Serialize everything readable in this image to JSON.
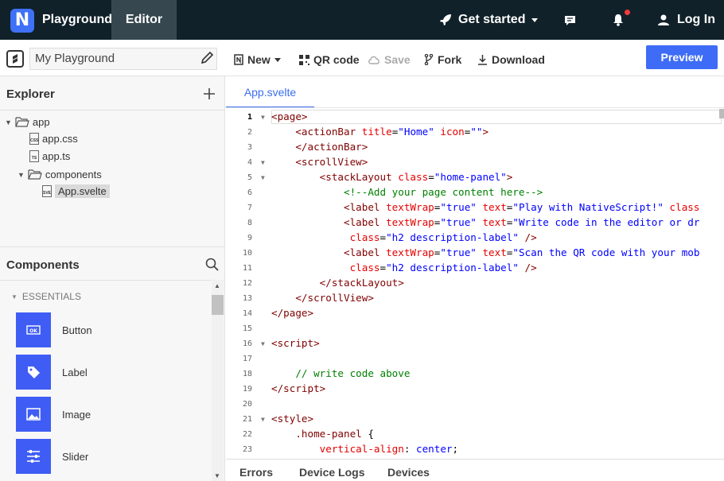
{
  "nav": {
    "logo_letter": "N",
    "brand": "Playground",
    "editor_tab": "Editor",
    "get_started": "Get started",
    "login": "Log In"
  },
  "toolbar": {
    "playground_name": "My Playground",
    "new": "New",
    "qr": "QR code",
    "save": "Save",
    "fork": "Fork",
    "download": "Download",
    "preview": "Preview"
  },
  "explorer": {
    "title": "Explorer",
    "tree": [
      {
        "label": "app"
      },
      {
        "label": "app.css",
        "ext": "CSS"
      },
      {
        "label": "app.ts",
        "ext": "TS"
      },
      {
        "label": "components"
      },
      {
        "label": "App.svelte",
        "ext": "SVE"
      }
    ]
  },
  "components": {
    "title": "Components",
    "section": "ESSENTIALS",
    "items": [
      {
        "label": "Button"
      },
      {
        "label": "Label"
      },
      {
        "label": "Image"
      },
      {
        "label": "Slider"
      }
    ]
  },
  "editor": {
    "file_tab": "App.svelte",
    "lines": [
      {
        "n": "1",
        "html": "<span class=\"t\">&lt;page&gt;</span>"
      },
      {
        "n": "2",
        "html": "    <span class=\"t\">&lt;actionBar</span> <span class=\"a\">title</span>=<span class=\"s\">\"Home\"</span> <span class=\"a\">icon</span>=<span class=\"s\">\"\"</span><span class=\"t\">&gt;</span>"
      },
      {
        "n": "3",
        "html": "    <span class=\"t\">&lt;/actionBar&gt;</span>"
      },
      {
        "n": "4",
        "html": "    <span class=\"t\">&lt;scrollView&gt;</span>"
      },
      {
        "n": "5",
        "html": "        <span class=\"t\">&lt;stackLayout</span> <span class=\"a\">class</span>=<span class=\"s\">\"home-panel\"</span><span class=\"t\">&gt;</span>"
      },
      {
        "n": "6",
        "html": "            <span class=\"c\">&lt;!--Add your page content here--&gt;</span>"
      },
      {
        "n": "7",
        "html": "            <span class=\"t\">&lt;label</span> <span class=\"a\">textWrap</span>=<span class=\"s\">\"true\"</span> <span class=\"a\">text</span>=<span class=\"s\">\"Play with NativeScript!\"</span> <span class=\"a\">class</span>"
      },
      {
        "n": "8",
        "html": "            <span class=\"t\">&lt;label</span> <span class=\"a\">textWrap</span>=<span class=\"s\">\"true\"</span> <span class=\"a\">text</span>=<span class=\"s\">\"Write code in the editor or dr</span>"
      },
      {
        "n": "9",
        "html": "             <span class=\"a\">class</span>=<span class=\"s\">\"h2 description-label\"</span> <span class=\"t\">/&gt;</span>"
      },
      {
        "n": "10",
        "html": "            <span class=\"t\">&lt;label</span> <span class=\"a\">textWrap</span>=<span class=\"s\">\"true\"</span> <span class=\"a\">text</span>=<span class=\"s\">\"Scan the QR code with your mob</span>"
      },
      {
        "n": "11",
        "html": "             <span class=\"a\">class</span>=<span class=\"s\">\"h2 description-label\"</span> <span class=\"t\">/&gt;</span>"
      },
      {
        "n": "12",
        "html": "        <span class=\"t\">&lt;/stackLayout&gt;</span>"
      },
      {
        "n": "13",
        "html": "    <span class=\"t\">&lt;/scrollView&gt;</span>"
      },
      {
        "n": "14",
        "html": "<span class=\"t\">&lt;/page&gt;</span>"
      },
      {
        "n": "15",
        "html": ""
      },
      {
        "n": "16",
        "html": "<span class=\"t\">&lt;script&gt;</span>"
      },
      {
        "n": "17",
        "html": ""
      },
      {
        "n": "18",
        "html": "    <span class=\"c\">// write code above</span>"
      },
      {
        "n": "19",
        "html": "<span class=\"t\">&lt;/script&gt;</span>"
      },
      {
        "n": "20",
        "html": ""
      },
      {
        "n": "21",
        "html": "<span class=\"t\">&lt;style&gt;</span>"
      },
      {
        "n": "22",
        "html": "    <span class=\"t\">.home-panel</span> {"
      },
      {
        "n": "23",
        "html": "        <span class=\"a\">vertical-align</span>: <span class=\"s\">center</span>;"
      }
    ],
    "folds": [
      "1",
      "4",
      "5",
      "16",
      "21"
    ]
  },
  "bottom_tabs": [
    "Errors",
    "Device Logs",
    "Devices"
  ],
  "colors": {
    "accent": "#3e6cf6",
    "nav_bg": "#102129"
  }
}
